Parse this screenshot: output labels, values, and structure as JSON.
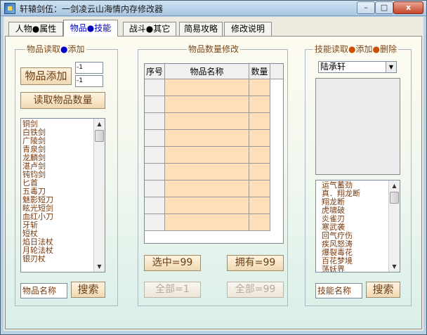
{
  "window": {
    "title": "轩辕剑伍：一剑凌云山海情内存修改器",
    "min_glyph": "–",
    "max_glyph": "□",
    "close_glyph": "x"
  },
  "tabs": [
    {
      "label": "人物●属性",
      "active": false
    },
    {
      "label": "物品●技能",
      "active": true
    },
    {
      "label": "战斗●其它",
      "active": false
    },
    {
      "label": "简易攻略",
      "active": false
    },
    {
      "label": "修改说明",
      "active": false
    }
  ],
  "items_group": {
    "title_a": "物品读取",
    "dot": "●",
    "title_b": "添加",
    "add_button": "物品添加",
    "field1": "-1",
    "field2": "-1",
    "read_qty_button": "读取物品数量",
    "list": [
      "铜剑",
      "白铁剑",
      "广陵剑",
      "青泉剑",
      "龙麟剑",
      "湛卢剑",
      "钝钧剑",
      "匕首",
      "五毒刀",
      "魅影短刀",
      "眩光短剑",
      "血红小刀",
      "牙斩",
      "短杖",
      "焰日法杖",
      "月轮法杖",
      "银刃杖"
    ],
    "search_input": "物品名称",
    "search_button": "搜索"
  },
  "qty_group": {
    "title": "物品数量修改",
    "col_index": "序号",
    "col_name": "物品名称",
    "col_qty": "数量",
    "row_count": 9,
    "btn_selected": "选中=99",
    "btn_owned": "拥有=99",
    "btn_all1": "全部=1",
    "btn_all99": "全部=99"
  },
  "skills_group": {
    "title_a": "技能读取",
    "dot": "●",
    "title_b": "添加",
    "title_c": "删除",
    "character_select": "陆承轩",
    "list": [
      "运气蓄劲",
      "真．翔龙断",
      "翔龙断",
      "虎啸破",
      "炎雀刃",
      "寒武袭",
      "回气疗伤",
      "疾风怒涛",
      "爆裂毒花",
      "百花梦境",
      "荡妖界"
    ],
    "search_input": "技能名称",
    "search_button": "搜索"
  }
}
